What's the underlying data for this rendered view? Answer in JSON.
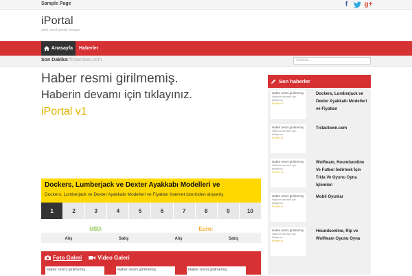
{
  "topbar": {
    "sample_page": "Sample Page"
  },
  "social": {
    "facebook": "f",
    "twitter": "t",
    "google": "g+"
  },
  "logo": {
    "brand": "iPortal",
    "tagline": "yeni nesil portal temasi"
  },
  "nav": {
    "home": "Anasayfa",
    "news": "Haberler"
  },
  "breaking": {
    "label": "Son Dakika:",
    "text": "Tictactown.com",
    "search_placeholder": "Arama..."
  },
  "hero": {
    "line1": "Haber resmi girilmemiş.",
    "line2": "Haberin devamı için tıklayınız.",
    "line3": "iPortal v1"
  },
  "featured": {
    "title": "Dockers, Lumberjack ve Dexter Ayakkabı Modelleri ve",
    "summary": "Dockers, Lumberjack ve Dexter Ayakkabı Modelleri ve Fiyatları İnternet üzerinden alışveriş"
  },
  "pager": [
    "1",
    "2",
    "3",
    "4",
    "5",
    "6",
    "7",
    "8",
    "9",
    "10"
  ],
  "markets": {
    "usd": {
      "label": "USD:",
      "buy": "Alış",
      "sell": "Satış"
    },
    "euro": {
      "label": "Euro:",
      "buy": "Alış",
      "sell": "Satış"
    }
  },
  "gallery": {
    "photo_tab": "Foto Galeri",
    "video_tab": "Video Galeri",
    "thumbs": [
      "Haber resmi girilmemiş.",
      "Haber resmi girilmemiş.",
      "Haber resmi girilmemiş."
    ]
  },
  "sidebar": {
    "title": "Son haberler",
    "thumb_line1": "Haber resmi girilmemiş.",
    "thumb_line2": "Haberin devamı için tıklayınız.",
    "thumb_line3": "iPortal v1",
    "items": [
      {
        "title": "Dockers, Lumberjack ve Dexter Ayakkabı Modelleri ve Fiyatları"
      },
      {
        "title": "Tictactown.com"
      },
      {
        "title": "Wolfteam, Houndsonline Ve Futbol İndirmek İçin Tıkla Ve Oyunu Oyna İşlemleri"
      },
      {
        "title": "Mobil Oyunlar"
      },
      {
        "title": "Houndsonline, Rip ve Wolfteam Oyunu Oyna"
      }
    ]
  },
  "colors": {
    "accent": "#d63133",
    "featured": "#ffd800",
    "dark": "#333333"
  }
}
